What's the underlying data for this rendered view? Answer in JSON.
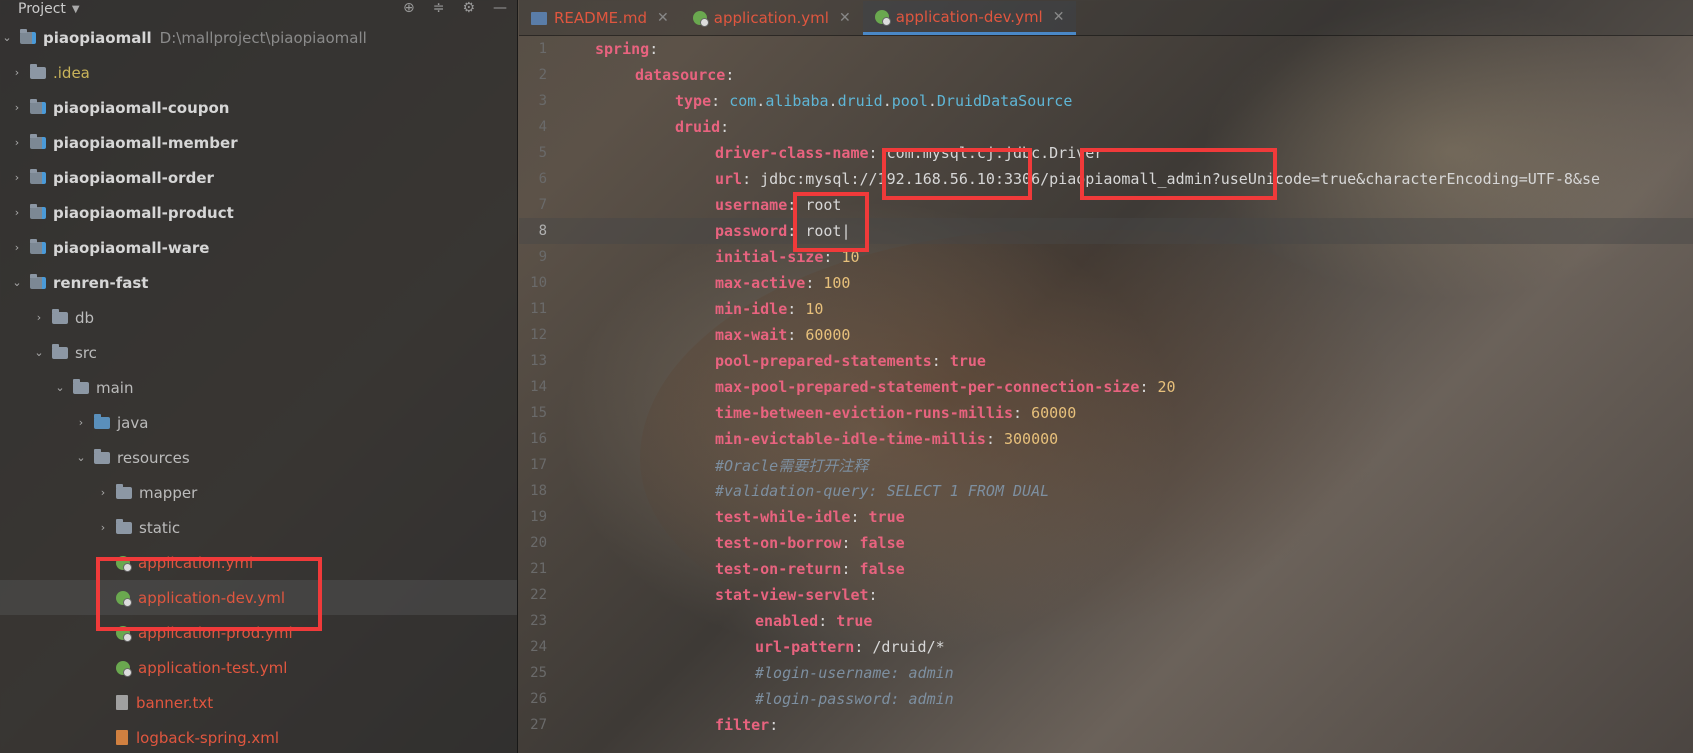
{
  "panel": {
    "title": "Project",
    "root_name": "piaopiaomall",
    "root_path": "D:\\mallproject\\piaopiaomall",
    "items": [
      {
        "label": ".idea",
        "kind": "idea"
      },
      {
        "label": "piaopiaomall-coupon",
        "kind": "module"
      },
      {
        "label": "piaopiaomall-member",
        "kind": "module"
      },
      {
        "label": "piaopiaomall-order",
        "kind": "module"
      },
      {
        "label": "piaopiaomall-product",
        "kind": "module"
      },
      {
        "label": "piaopiaomall-ware",
        "kind": "module"
      },
      {
        "label": "renren-fast",
        "kind": "module"
      },
      {
        "label": "db",
        "kind": "folder"
      },
      {
        "label": "src",
        "kind": "folder"
      },
      {
        "label": "main",
        "kind": "folder"
      },
      {
        "label": "java",
        "kind": "folder"
      },
      {
        "label": "resources",
        "kind": "folder"
      },
      {
        "label": "mapper",
        "kind": "folder"
      },
      {
        "label": "static",
        "kind": "folder"
      },
      {
        "label": "application.yml",
        "kind": "yml"
      },
      {
        "label": "application-dev.yml",
        "kind": "yml"
      },
      {
        "label": "application-prod.yml",
        "kind": "yml"
      },
      {
        "label": "application-test.yml",
        "kind": "yml"
      },
      {
        "label": "banner.txt",
        "kind": "txt"
      },
      {
        "label": "logback-spring.xml",
        "kind": "xml"
      }
    ]
  },
  "tabs": [
    {
      "label": "README.md"
    },
    {
      "label": "application.yml"
    },
    {
      "label": "application-dev.yml"
    }
  ],
  "code": {
    "l1": {
      "num": "1",
      "key": "spring"
    },
    "l2": {
      "num": "2",
      "key": "datasource"
    },
    "l3": {
      "num": "3",
      "key": "type",
      "p1": "com",
      "p2": "alibaba",
      "p3": "druid",
      "p4": "pool",
      "p5": "DruidDataSource"
    },
    "l4": {
      "num": "4",
      "key": "druid"
    },
    "l5": {
      "num": "5",
      "key": "driver-class-name",
      "value": "com.mysql.cj.jdbc.Driver"
    },
    "l6": {
      "num": "6",
      "key": "url",
      "value": "jdbc:mysql://192.168.56.10:3306/piaopiaomall_admin?useUnicode=true&characterEncoding=UTF-8&se"
    },
    "l7": {
      "num": "7",
      "key": "username",
      "value": "root"
    },
    "l8": {
      "num": "8",
      "key": "password",
      "value": "root"
    },
    "l9": {
      "num": "9",
      "key": "initial-size",
      "value": "10"
    },
    "l10": {
      "num": "10",
      "key": "max-active",
      "value": "100"
    },
    "l11": {
      "num": "11",
      "key": "min-idle",
      "value": "10"
    },
    "l12": {
      "num": "12",
      "key": "max-wait",
      "value": "60000"
    },
    "l13": {
      "num": "13",
      "key": "pool-prepared-statements",
      "value": "true"
    },
    "l14": {
      "num": "14",
      "key": "max-pool-prepared-statement-per-connection-size",
      "value": "20"
    },
    "l15": {
      "num": "15",
      "key": "time-between-eviction-runs-millis",
      "value": "60000"
    },
    "l16": {
      "num": "16",
      "key": "min-evictable-idle-time-millis",
      "value": "300000"
    },
    "l17": {
      "num": "17",
      "comment": "#Oracle需要打开注释"
    },
    "l18": {
      "num": "18",
      "comment": "#validation-query: SELECT 1 FROM DUAL"
    },
    "l19": {
      "num": "19",
      "key": "test-while-idle",
      "value": "true"
    },
    "l20": {
      "num": "20",
      "key": "test-on-borrow",
      "value": "false"
    },
    "l21": {
      "num": "21",
      "key": "test-on-return",
      "value": "false"
    },
    "l22": {
      "num": "22",
      "key": "stat-view-servlet"
    },
    "l23": {
      "num": "23",
      "key": "enabled",
      "value": "true"
    },
    "l24": {
      "num": "24",
      "key": "url-pattern",
      "value": "/druid/*"
    },
    "l25": {
      "num": "25",
      "comment": "#login-username: admin"
    },
    "l26": {
      "num": "26",
      "comment": "#login-password: admin"
    },
    "l27": {
      "num": "27",
      "key": "filter"
    }
  }
}
